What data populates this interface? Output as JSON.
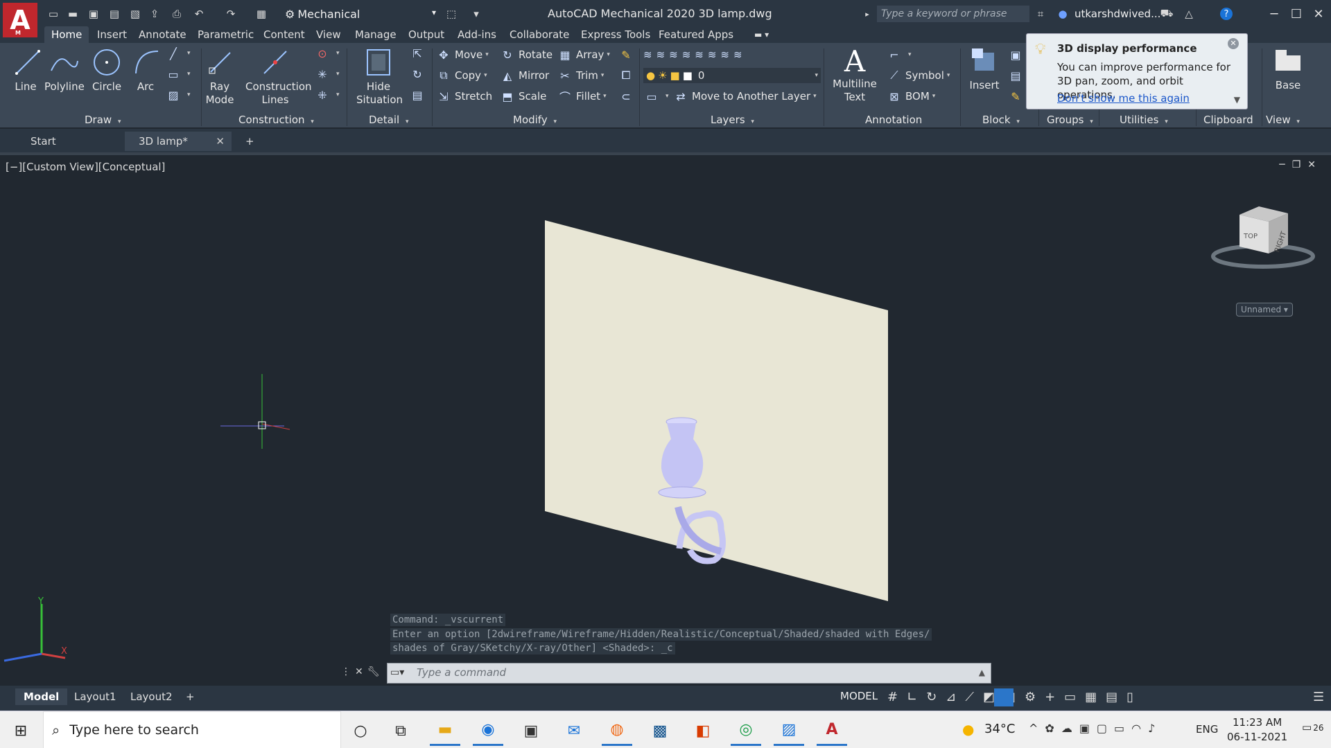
{
  "titlebar": {
    "workspace": "Mechanical",
    "title": "AutoCAD Mechanical 2020    3D lamp.dwg",
    "search_placeholder": "Type a keyword or phrase",
    "user": "utkarshdwived...",
    "logo_letter": "A",
    "logo_sub": "M"
  },
  "tabs": [
    "Home",
    "Insert",
    "Annotate",
    "Parametric",
    "Content",
    "View",
    "Manage",
    "Output",
    "Add-ins",
    "Collaborate",
    "Express Tools",
    "Featured Apps"
  ],
  "ribbon": {
    "draw": {
      "line": "Line",
      "polyline": "Polyline",
      "circle": "Circle",
      "arc": "Arc",
      "label": "Draw"
    },
    "construction": {
      "ray_mode": [
        "Ray",
        "Mode"
      ],
      "construction_lines": [
        "Construction",
        "Lines"
      ],
      "label": "Construction"
    },
    "detail": {
      "hide_situation": [
        "Hide",
        "Situation"
      ],
      "label": "Detail"
    },
    "modify": {
      "move": "Move",
      "rotate": "Rotate",
      "array": "Array",
      "copy": "Copy",
      "mirror": "Mirror",
      "trim": "Trim",
      "stretch": "Stretch",
      "scale": "Scale",
      "fillet": "Fillet",
      "label": "Modify"
    },
    "layers": {
      "current_layer": "0",
      "move_to_layer": "Move to Another Layer",
      "label": "Layers"
    },
    "annotation": {
      "multiline_text": [
        "Multiline",
        "Text"
      ],
      "symbol": "Symbol",
      "bom": "BOM",
      "label": "Annotation"
    },
    "block": {
      "insert": "Insert",
      "label": "Block"
    },
    "groups": {
      "label": "Groups"
    },
    "utilities": {
      "label": "Utilities"
    },
    "clipboard": {
      "label": "Clipboard"
    },
    "view": {
      "base": "Base",
      "label": "View"
    }
  },
  "popup": {
    "title": "3D display performance",
    "body": "You can improve performance for 3D pan, zoom, and orbit operations.",
    "link": "Don't show me this again"
  },
  "doc_tabs": {
    "start": "Start",
    "active": "3D lamp*"
  },
  "viewport": {
    "label": "[−][Custom View][Conceptual]",
    "viewcube_top": "TOP",
    "viewcube_right": "RIGHT",
    "unnamed": "Unnamed"
  },
  "command": {
    "history": [
      "Command:  _vscurrent",
      "Enter an option [2dwireframe/Wireframe/Hidden/Realistic/Conceptual/Shaded/shaded with Edges/",
      "shades of Gray/SKetchy/X-ray/Other] <Shaded>: _c"
    ],
    "placeholder": "Type a command"
  },
  "layouts": [
    "Model",
    "Layout1",
    "Layout2"
  ],
  "status": {
    "model": "MODEL"
  },
  "taskbar": {
    "search": "Type here to search",
    "temp": "34°C",
    "lang": "ENG",
    "time": "11:23 AM",
    "date": "06-11-2021",
    "notifications": "26"
  },
  "colors": {
    "accent": "#2b76c9",
    "brand": "#c0272d",
    "plane": "#e8e6d5",
    "lamp": "#b9b9f2"
  }
}
